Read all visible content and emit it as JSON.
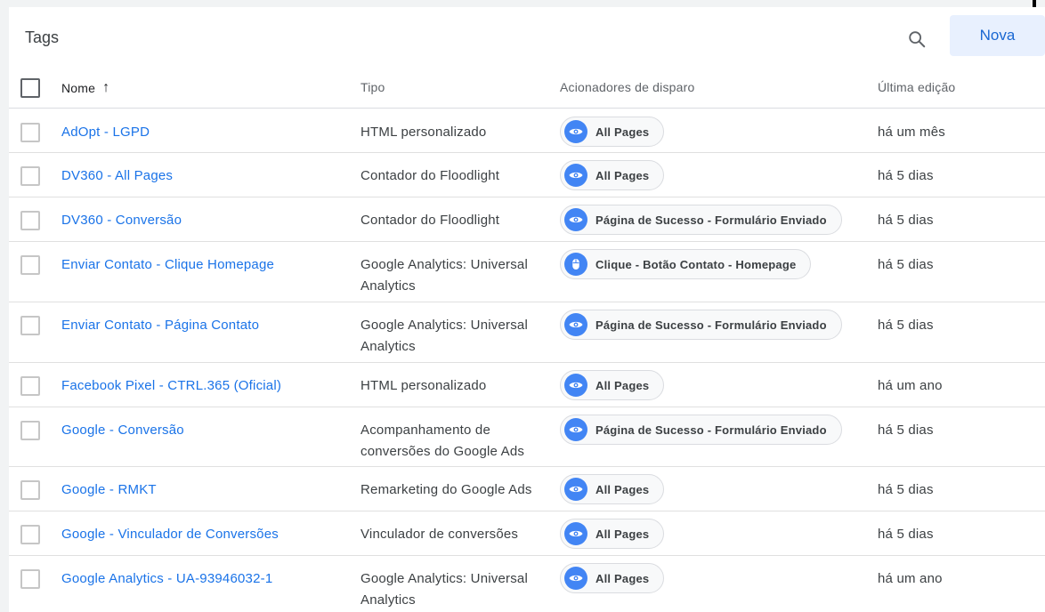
{
  "header": {
    "title": "Tags",
    "new_button": "Nova",
    "search_icon": "search-icon"
  },
  "columns": {
    "name": "Nome",
    "sort_indicator": "↑",
    "type": "Tipo",
    "triggers": "Acionadores de disparo",
    "last_edit": "Última edição"
  },
  "colors": {
    "accent": "#1a73e8",
    "chip_icon_bg": "#4285f4",
    "button_bg": "#e8f0fe"
  },
  "rows": [
    {
      "name": "AdOpt - LGPD",
      "type": "HTML personalizado",
      "trigger": {
        "icon": "eye-icon",
        "label": "All Pages"
      },
      "last_edit": "há um mês"
    },
    {
      "name": "DV360 - All Pages",
      "type": "Contador do Floodlight",
      "trigger": {
        "icon": "eye-icon",
        "label": "All Pages"
      },
      "last_edit": "há 5 dias"
    },
    {
      "name": "DV360 - Conversão",
      "type": "Contador do Floodlight",
      "trigger": {
        "icon": "eye-icon",
        "label": "Página de Sucesso - Formulário Enviado"
      },
      "last_edit": "há 5 dias"
    },
    {
      "name": "Enviar Contato - Clique Homepage",
      "type": "Google Analytics: Universal Analytics",
      "trigger": {
        "icon": "mouse-icon",
        "label": "Clique - Botão Contato - Homepage"
      },
      "last_edit": "há 5 dias"
    },
    {
      "name": "Enviar Contato - Página Contato",
      "type": "Google Analytics: Universal Analytics",
      "trigger": {
        "icon": "eye-icon",
        "label": "Página de Sucesso - Formulário Enviado"
      },
      "last_edit": "há 5 dias"
    },
    {
      "name": "Facebook Pixel - CTRL.365 (Oficial)",
      "type": "HTML personalizado",
      "trigger": {
        "icon": "eye-icon",
        "label": "All Pages"
      },
      "last_edit": "há um ano"
    },
    {
      "name": "Google - Conversão",
      "type": "Acompanhamento de conversões do Google Ads",
      "trigger": {
        "icon": "eye-icon",
        "label": "Página de Sucesso - Formulário Enviado"
      },
      "last_edit": "há 5 dias"
    },
    {
      "name": "Google - RMKT",
      "type": "Remarketing do Google Ads",
      "trigger": {
        "icon": "eye-icon",
        "label": "All Pages"
      },
      "last_edit": "há 5 dias"
    },
    {
      "name": "Google - Vinculador de Conversões",
      "type": "Vinculador de conversões",
      "trigger": {
        "icon": "eye-icon",
        "label": "All Pages"
      },
      "last_edit": "há 5 dias"
    },
    {
      "name": "Google Analytics - UA-93946032-1",
      "type": "Google Analytics: Universal Analytics",
      "trigger": {
        "icon": "eye-icon",
        "label": "All Pages"
      },
      "last_edit": "há um ano"
    }
  ]
}
